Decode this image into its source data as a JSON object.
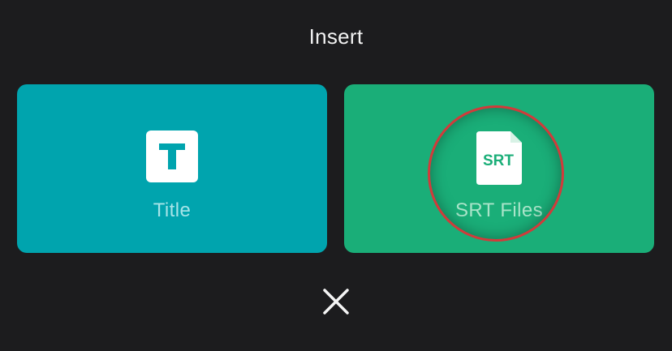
{
  "header": {
    "title": "Insert"
  },
  "options": [
    {
      "id": "title",
      "label": "Title",
      "icon": "title-t-icon",
      "color": "#00a4ae"
    },
    {
      "id": "srt",
      "label": "SRT Files",
      "icon": "srt-file-icon",
      "icon_text": "SRT",
      "color": "#1aae78",
      "highlighted": true,
      "highlight_color": "#d23a3a"
    }
  ],
  "close": {
    "icon": "close-icon"
  }
}
